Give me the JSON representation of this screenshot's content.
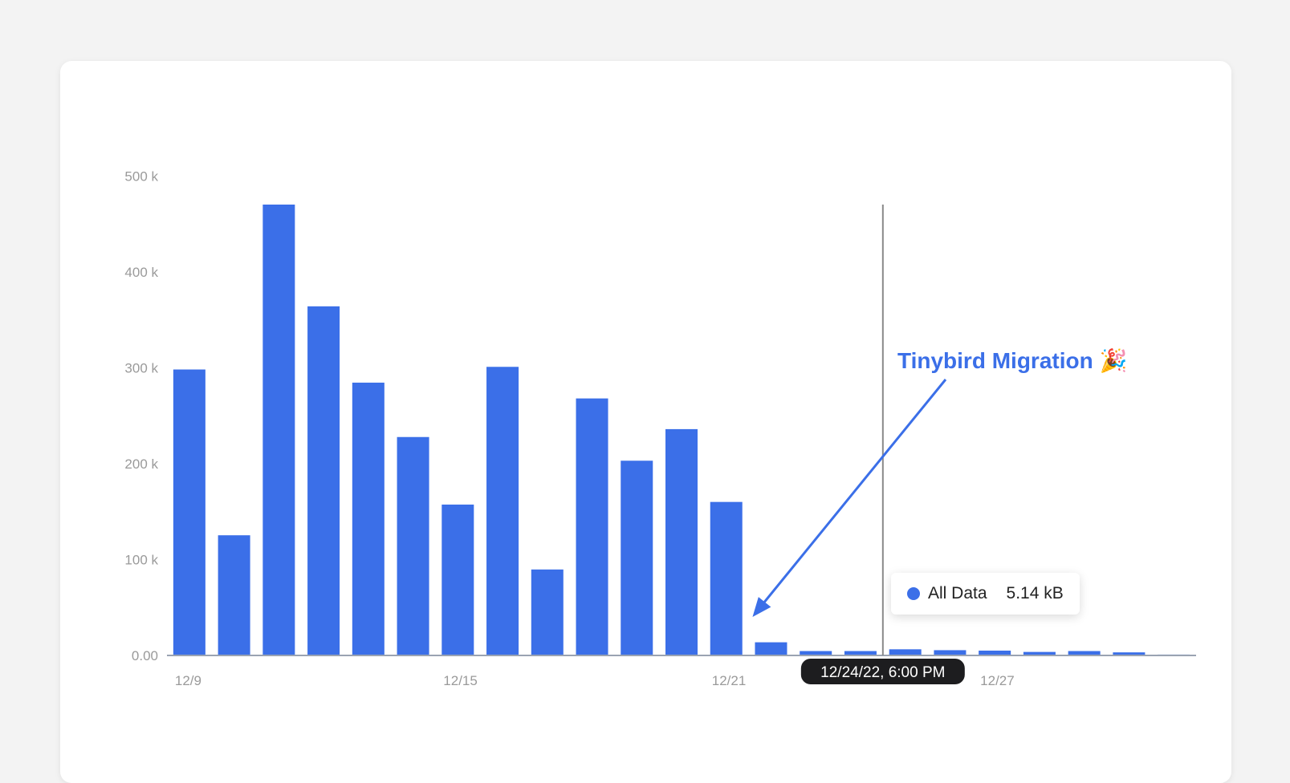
{
  "chart_data": {
    "type": "bar",
    "categories": [
      "12/9",
      "12/10",
      "12/11",
      "12/12",
      "12/13",
      "12/14",
      "12/15",
      "12/16",
      "12/17",
      "12/18",
      "12/19",
      "12/20",
      "12/21",
      "12/22",
      "12/23",
      "12/24",
      "12/25",
      "12/26",
      "12/27",
      "12/28",
      "12/29",
      "12/30",
      "12/31"
    ],
    "series": [
      {
        "name": "All Data",
        "color": "#3b6fe8",
        "values": [
          326000,
          137000,
          514000,
          398000,
          311000,
          249000,
          172000,
          329000,
          98000,
          293000,
          222000,
          258000,
          175000,
          15000,
          5000,
          5000,
          7000,
          6000,
          5500,
          4000,
          5000,
          3500,
          1000
        ]
      }
    ],
    "ylim": [
      0,
      514000
    ],
    "y_ticks": [
      "0.00",
      "100 k",
      "200 k",
      "300 k",
      "400 k",
      "500 k"
    ],
    "x_tick_labels": [
      {
        "category": "12/9",
        "label": "12/9"
      },
      {
        "category": "12/15",
        "label": "12/15"
      },
      {
        "category": "12/21",
        "label": "12/21"
      },
      {
        "category": "12/27",
        "label": "12/27"
      }
    ],
    "hover": {
      "x_label": "12/24/22, 6:00 PM",
      "series_name": "All Data",
      "value_text": "5.14 kB"
    },
    "annotation": {
      "text": "Tinybird Migration 🎉",
      "arrow_target_category": "12/22"
    }
  }
}
